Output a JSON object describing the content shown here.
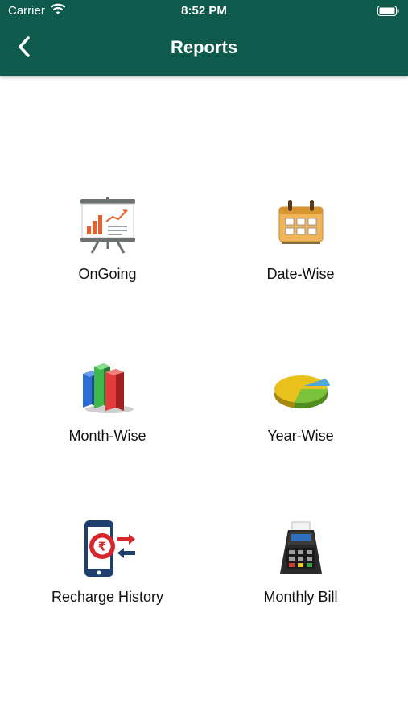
{
  "status_bar": {
    "carrier": "Carrier",
    "time": "8:52 PM"
  },
  "header": {
    "title": "Reports",
    "back_icon": "chevron-left-icon"
  },
  "menu": [
    {
      "label": "OnGoing",
      "icon": "presentation-board-icon"
    },
    {
      "label": "Date-Wise",
      "icon": "calendar-icon"
    },
    {
      "label": "Month-Wise",
      "icon": "bar-chart-3d-icon"
    },
    {
      "label": "Year-Wise",
      "icon": "pie-chart-icon"
    },
    {
      "label": "Recharge History",
      "icon": "mobile-rupee-recharge-icon"
    },
    {
      "label": "Monthly Bill",
      "icon": "card-terminal-icon"
    }
  ],
  "colors": {
    "header_bg": "#0e5a4c",
    "background": "#ffffff",
    "text": "#111111"
  }
}
